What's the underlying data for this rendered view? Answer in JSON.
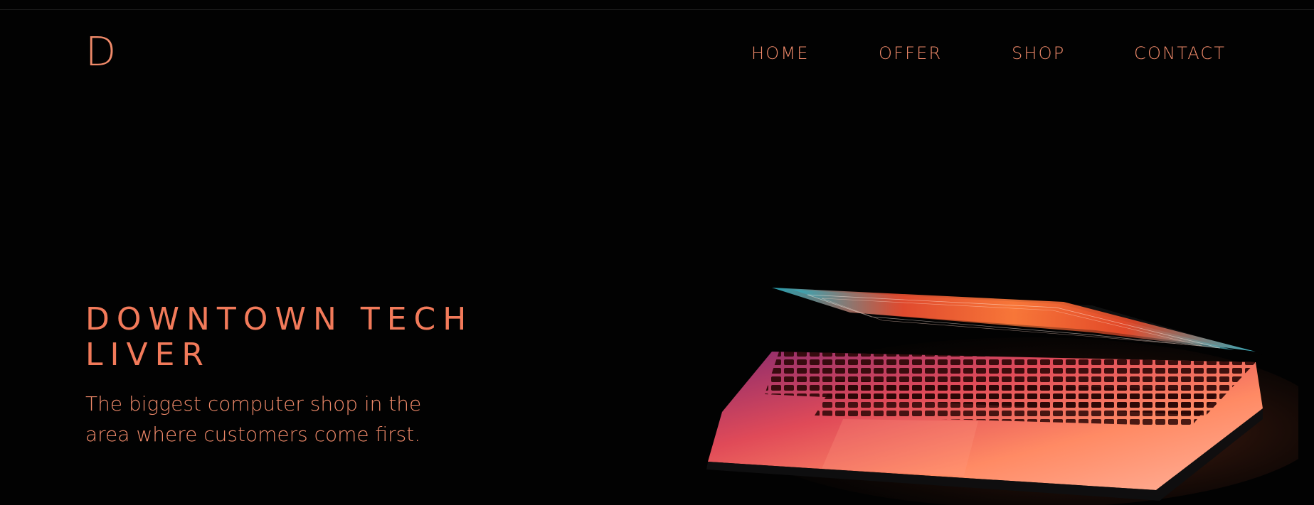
{
  "colors": {
    "background": "#020202",
    "accent": "#f08a6a",
    "accent_strong": "#f27a5a"
  },
  "logo": {
    "text": "D"
  },
  "nav": {
    "items": [
      {
        "label": "HOME"
      },
      {
        "label": "OFFER"
      },
      {
        "label": "SHOP"
      },
      {
        "label": "CONTACT"
      }
    ]
  },
  "hero": {
    "title": "DOWNTOWN TECH LIVER",
    "subtitle": "The biggest computer shop in the area where customers come first."
  },
  "images": {
    "hero_image": "laptop-illustration"
  }
}
